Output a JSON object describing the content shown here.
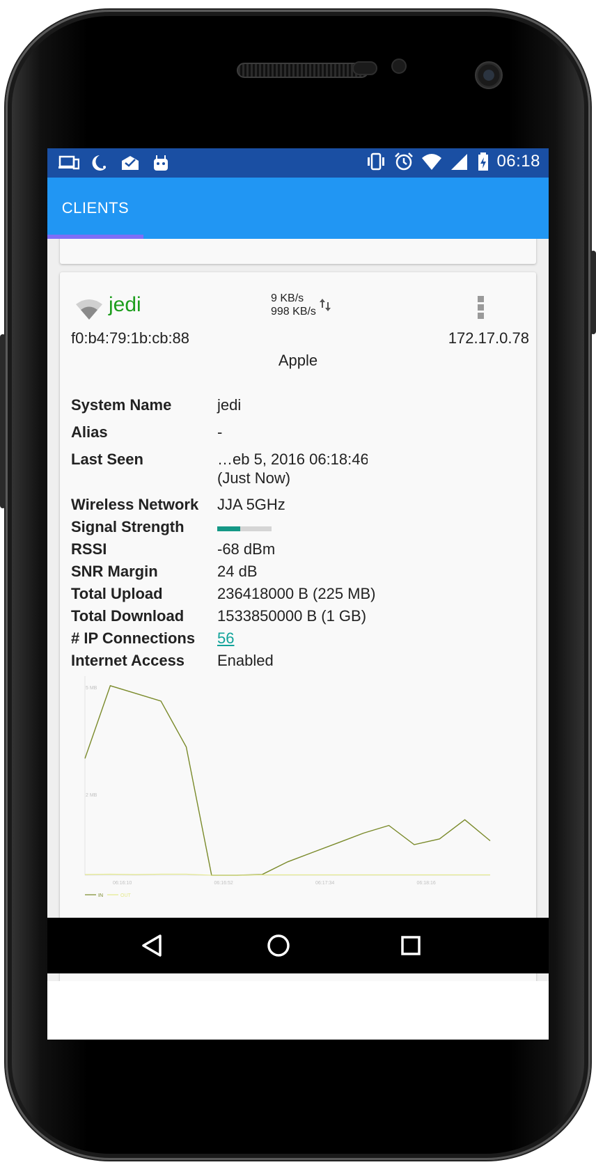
{
  "statusbar": {
    "time": "06:18",
    "left_icons": [
      "cast-icon",
      "moon-icon",
      "mail-done-icon",
      "android-icon"
    ],
    "right_icons": [
      "vibrate-icon",
      "alarm-icon",
      "wifi-icon",
      "cell-signal-icon",
      "battery-charging-icon"
    ]
  },
  "appbar": {
    "tabs": [
      {
        "label": "CLIENTS",
        "active": true
      }
    ]
  },
  "client": {
    "name": "jedi",
    "rate_up": "9 KB/s",
    "rate_down": "998 KB/s",
    "mac": "f0:b4:79:1b:cb:88",
    "ip": "172.17.0.78",
    "vendor": "Apple",
    "details": {
      "system_name": {
        "label": "System Name",
        "value": "jedi"
      },
      "alias": {
        "label": "Alias",
        "value": "-"
      },
      "last_seen": {
        "label": "Last Seen",
        "value": "…eb 5, 2016 06:18:46",
        "value2": "(Just Now)"
      },
      "wireless_network": {
        "label": "Wireless Network",
        "value": "JJA 5GHz"
      },
      "signal_strength": {
        "label": "Signal Strength",
        "fraction": 0.42
      },
      "rssi": {
        "label": "RSSI",
        "value": "-68 dBm"
      },
      "snr_margin": {
        "label": "SNR Margin",
        "value": "24 dB"
      },
      "total_upload": {
        "label": "Total Upload",
        "value": "236418000 B (225 MB)"
      },
      "total_download": {
        "label": "Total Download",
        "value": "1533850000 B (1 GB)"
      },
      "ip_connections": {
        "label": "# IP Connections",
        "value": "56"
      },
      "internet_access": {
        "label": "Internet Access",
        "value": "Enabled"
      }
    }
  },
  "chart_data": {
    "type": "line",
    "y_tick_labels": [
      "5 MB",
      "2 MB"
    ],
    "x_tick_labels": [
      "06:16:10",
      "06:16:52",
      "06:17:34",
      "06:18:16"
    ],
    "legend": [
      "IN",
      "OUT"
    ],
    "legend_placement": "bottom-left",
    "series": [
      {
        "name": "IN",
        "color": "#7a8a2a",
        "points": [
          [
            0,
            3.05
          ],
          [
            1,
            4.95
          ],
          [
            2,
            4.75
          ],
          [
            3,
            4.55
          ],
          [
            4,
            3.35
          ],
          [
            5,
            0.0
          ],
          [
            6,
            0.0
          ],
          [
            7,
            0.02
          ],
          [
            8,
            0.35
          ],
          [
            9,
            0.6
          ],
          [
            10,
            0.85
          ],
          [
            11,
            1.1
          ],
          [
            12,
            1.3
          ],
          [
            13,
            0.8
          ],
          [
            14,
            0.95
          ],
          [
            15,
            1.45
          ],
          [
            16,
            0.9
          ]
        ]
      },
      {
        "name": "OUT",
        "color": "#e4e98a",
        "points": [
          [
            0,
            0.02
          ],
          [
            1,
            0.03
          ],
          [
            2,
            0.02
          ],
          [
            3,
            0.03
          ],
          [
            4,
            0.03
          ],
          [
            5,
            0.0
          ],
          [
            6,
            0.0
          ],
          [
            7,
            0.01
          ],
          [
            8,
            0.01
          ],
          [
            9,
            0.01
          ],
          [
            10,
            0.01
          ],
          [
            11,
            0.01
          ],
          [
            12,
            0.01
          ],
          [
            13,
            0.01
          ],
          [
            14,
            0.01
          ],
          [
            15,
            0.01
          ],
          [
            16,
            0.01
          ]
        ]
      }
    ],
    "ylim": [
      0,
      5.2
    ],
    "xlim": [
      0,
      16
    ]
  },
  "navbar": {
    "buttons": [
      "back",
      "home",
      "recents"
    ]
  }
}
